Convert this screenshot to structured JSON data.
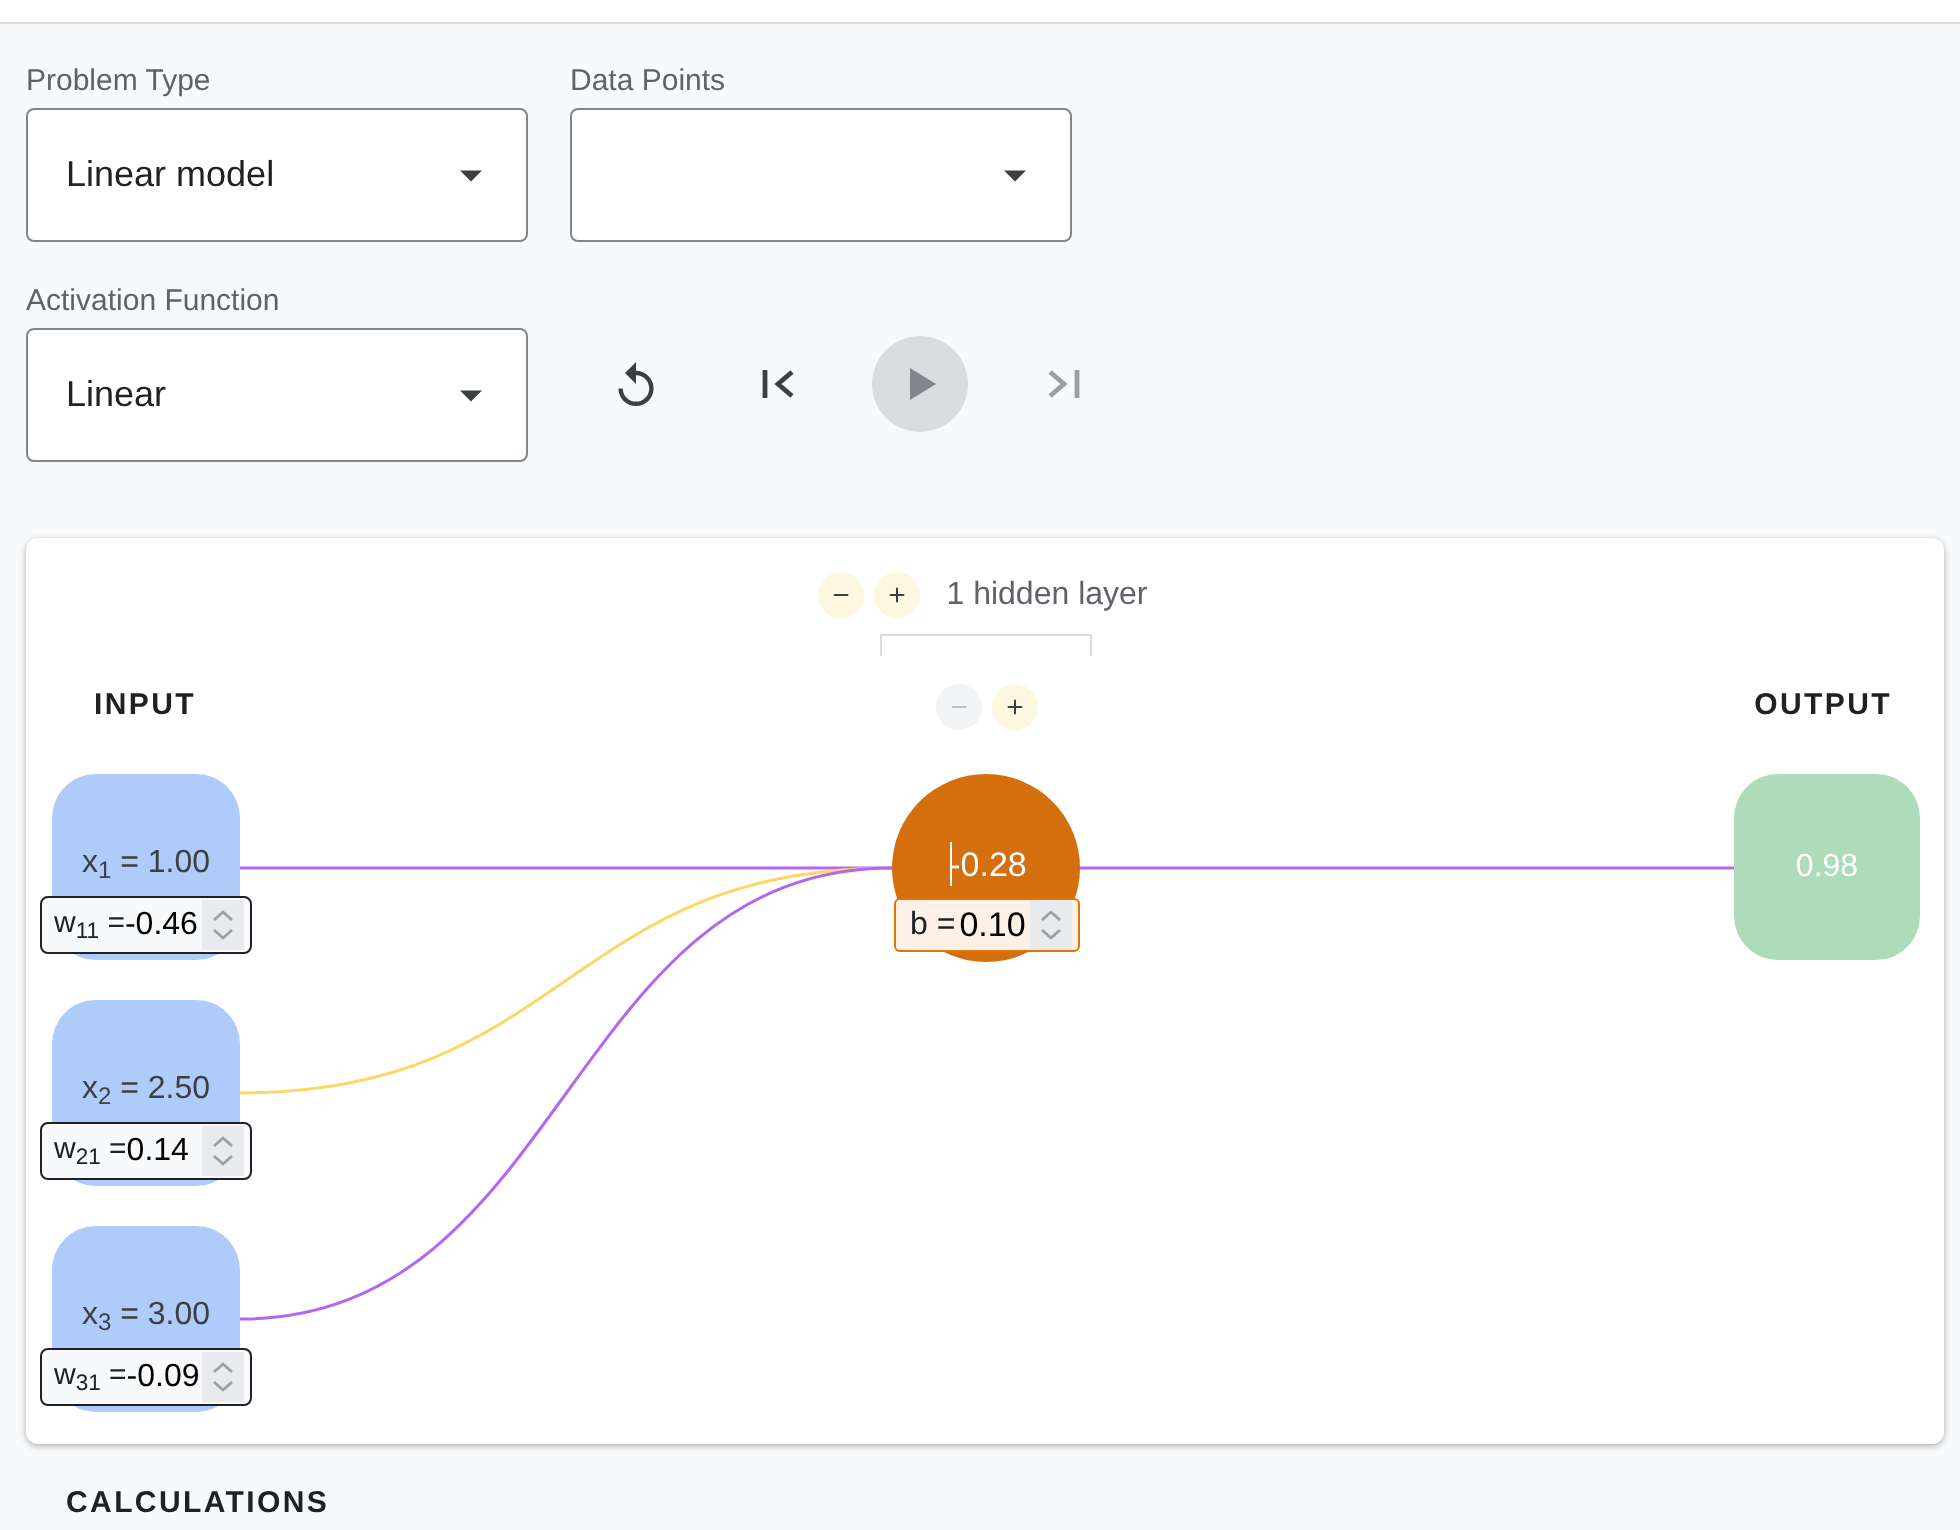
{
  "problem_type": {
    "label": "Problem Type",
    "value": "Linear model"
  },
  "data_points": {
    "label": "Data Points"
  },
  "activation_function": {
    "label": "Activation Function",
    "value": "Linear"
  },
  "playback": [
    {
      "kind": "reset",
      "disabled": false
    },
    {
      "kind": "step_back",
      "disabled": false
    },
    {
      "kind": "play",
      "disabled": true
    },
    {
      "kind": "step_forward",
      "disabled": true
    }
  ],
  "network": {
    "layer_count": "1 hidden layer",
    "layer_buttons": [
      {
        "kind": "remove",
        "disabled": false
      },
      {
        "kind": "add",
        "disabled": false
      }
    ],
    "neuron_buttons": [
      {
        "kind": "remove",
        "disabled": true
      },
      {
        "kind": "add",
        "disabled": false
      }
    ],
    "input_heading": "INPUT",
    "output_heading": "OUTPUT",
    "inputs": [
      {
        "label": "x$_{1}$ = 1.00",
        "weight_label": "w$_{11}$ =",
        "weight": "-0.46",
        "color": "#b366f2"
      },
      {
        "label": "x$_{2}$ = 2.50",
        "weight_label": "w$_{21}$ =",
        "weight": "0.14",
        "color": "#fdd663"
      },
      {
        "label": "x$_{3}$ = 3.00",
        "weight_label": "w$_{31}$ =",
        "weight": "-0.09",
        "color": "#b366f2"
      }
    ],
    "neuron": {
      "value": "-0.28",
      "focused": true,
      "bias_label": "b =",
      "bias": "0.10"
    },
    "output": {
      "value": "0.98",
      "color": "#b366f2"
    }
  },
  "calculations": {
    "title": "CALCULATIONS"
  }
}
